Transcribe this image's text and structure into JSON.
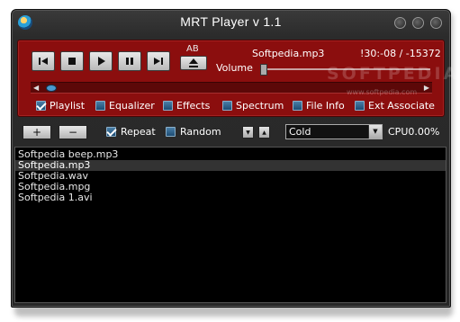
{
  "window": {
    "title": "MRT Player v 1.1"
  },
  "player": {
    "ab_label": "AB",
    "track_name": "Softpedia.mp3",
    "time_display": "!30:-08 / -15372",
    "volume_label": "Volume",
    "volume_level": 0.0,
    "seek_position": 0.02
  },
  "toggles": [
    {
      "label": "Playlist",
      "checked": true
    },
    {
      "label": "Equalizer",
      "checked": false
    },
    {
      "label": "Effects",
      "checked": false
    },
    {
      "label": "Spectrum",
      "checked": false
    },
    {
      "label": "File Info",
      "checked": false
    },
    {
      "label": "Ext Associate",
      "checked": false
    }
  ],
  "watermark": {
    "text": "SOFTPEDIA",
    "sub": "www.softpedia.com"
  },
  "controls": {
    "add_label": "+",
    "remove_label": "−",
    "repeat_label": "Repeat",
    "repeat_checked": true,
    "random_label": "Random",
    "random_checked": false,
    "preset_value": "Cold",
    "cpu_text": "CPU0.00%"
  },
  "playlist": [
    {
      "name": "Softpedia beep.mp3",
      "selected": false
    },
    {
      "name": "Softpedia.mp3",
      "selected": true
    },
    {
      "name": "Softpedia.wav",
      "selected": false
    },
    {
      "name": "Softpedia.mpg",
      "selected": false
    },
    {
      "name": "Softpedia 1.avi",
      "selected": false
    }
  ],
  "icons": {
    "prev": "skip-back-icon",
    "stop": "stop-icon",
    "play": "play-icon",
    "pause": "pause-icon",
    "next": "skip-forward-icon",
    "eject": "eject-icon"
  },
  "colors": {
    "panel": "#8b0e0e",
    "window": "#2b2b2b",
    "list_bg": "#000000"
  }
}
